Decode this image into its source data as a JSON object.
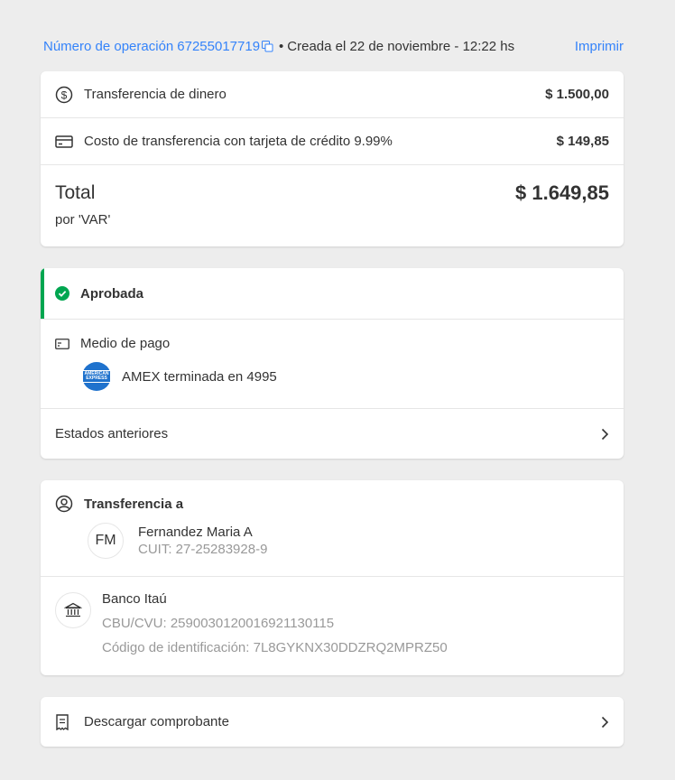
{
  "header": {
    "operation_label": "Número de operación",
    "operation_number": "67255017719",
    "created": "Creada el 22 de noviembre - 12:22 hs",
    "print_label": "Imprimir"
  },
  "summary": {
    "transfer_label": "Transferencia de dinero",
    "transfer_amount": "$ 1.500,00",
    "fee_label": "Costo de transferencia con tarjeta de crédito 9.99%",
    "fee_amount": "$ 149,85",
    "total_label": "Total",
    "total_amount": "$ 1.649,85",
    "total_sub": "por 'VAR'"
  },
  "status": {
    "approved_label": "Aprobada",
    "payment_method_label": "Medio de pago",
    "card_text": "AMEX terminada en 4995",
    "card_logo_text": "AMERICAN EXPRESS",
    "previous_states_label": "Estados anteriores"
  },
  "recipient": {
    "heading": "Transferencia a",
    "initials": "FM",
    "name": "Fernandez Maria A",
    "cuit": "CUIT: 27-25283928-9",
    "bank_name": "Banco Itaú",
    "cbu": "CBU/CVU: 2590030120016921130115",
    "id_code": "Código de identificación: 7L8GYKNX30DDZRQ2MPRZ50"
  },
  "download": {
    "label": "Descargar comprobante"
  },
  "colors": {
    "link": "#3483fa",
    "approved": "#00a650",
    "amex": "#1f72cd"
  }
}
